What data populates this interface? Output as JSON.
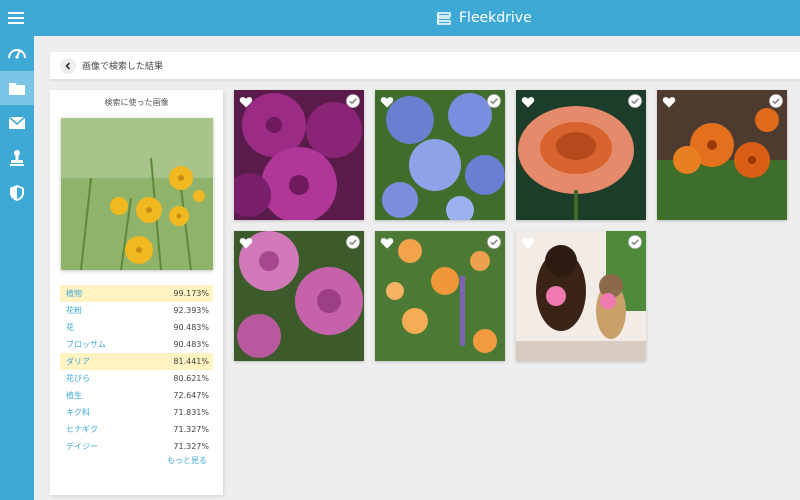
{
  "app": {
    "name": "Fleekdrive"
  },
  "colors": {
    "brand": "#3fa9d6",
    "highlight": "#fff3c2",
    "link": "#3fa9d6"
  },
  "icons": {
    "menu": "hamburger-icon",
    "sidebar": [
      "dashboard-icon",
      "folder-icon",
      "mail-icon",
      "stamp-icon",
      "shield-icon"
    ],
    "back": "chevron-left-icon",
    "favorite": "heart-icon",
    "select": "check-circle-icon"
  },
  "breadcrumb": {
    "text": "画像で検索した結果"
  },
  "search_panel": {
    "title": "検索に使った画像",
    "labels": [
      {
        "name": "植物",
        "score": "99.173%",
        "highlight": true
      },
      {
        "name": "花粉",
        "score": "92.393%",
        "highlight": false
      },
      {
        "name": "花",
        "score": "90.483%",
        "highlight": false
      },
      {
        "name": "ブロッサム",
        "score": "90.483%",
        "highlight": false
      },
      {
        "name": "ダリア",
        "score": "81.441%",
        "highlight": true
      },
      {
        "name": "花びら",
        "score": "80.621%",
        "highlight": false
      },
      {
        "name": "植生",
        "score": "72.647%",
        "highlight": false
      },
      {
        "name": "キク科",
        "score": "71.831%",
        "highlight": false
      },
      {
        "name": "ヒナギク",
        "score": "71.327%",
        "highlight": false
      },
      {
        "name": "デイジー",
        "score": "71.327%",
        "highlight": false
      }
    ],
    "more_label": "もっと見る"
  },
  "results": [
    {
      "subject": "magenta dahlias"
    },
    {
      "subject": "blue hydrangeas"
    },
    {
      "subject": "orange gerbera"
    },
    {
      "subject": "orange marigolds"
    },
    {
      "subject": "pink roses"
    },
    {
      "subject": "orange roses with lavender"
    },
    {
      "subject": "two dogs with pink flowers"
    }
  ]
}
